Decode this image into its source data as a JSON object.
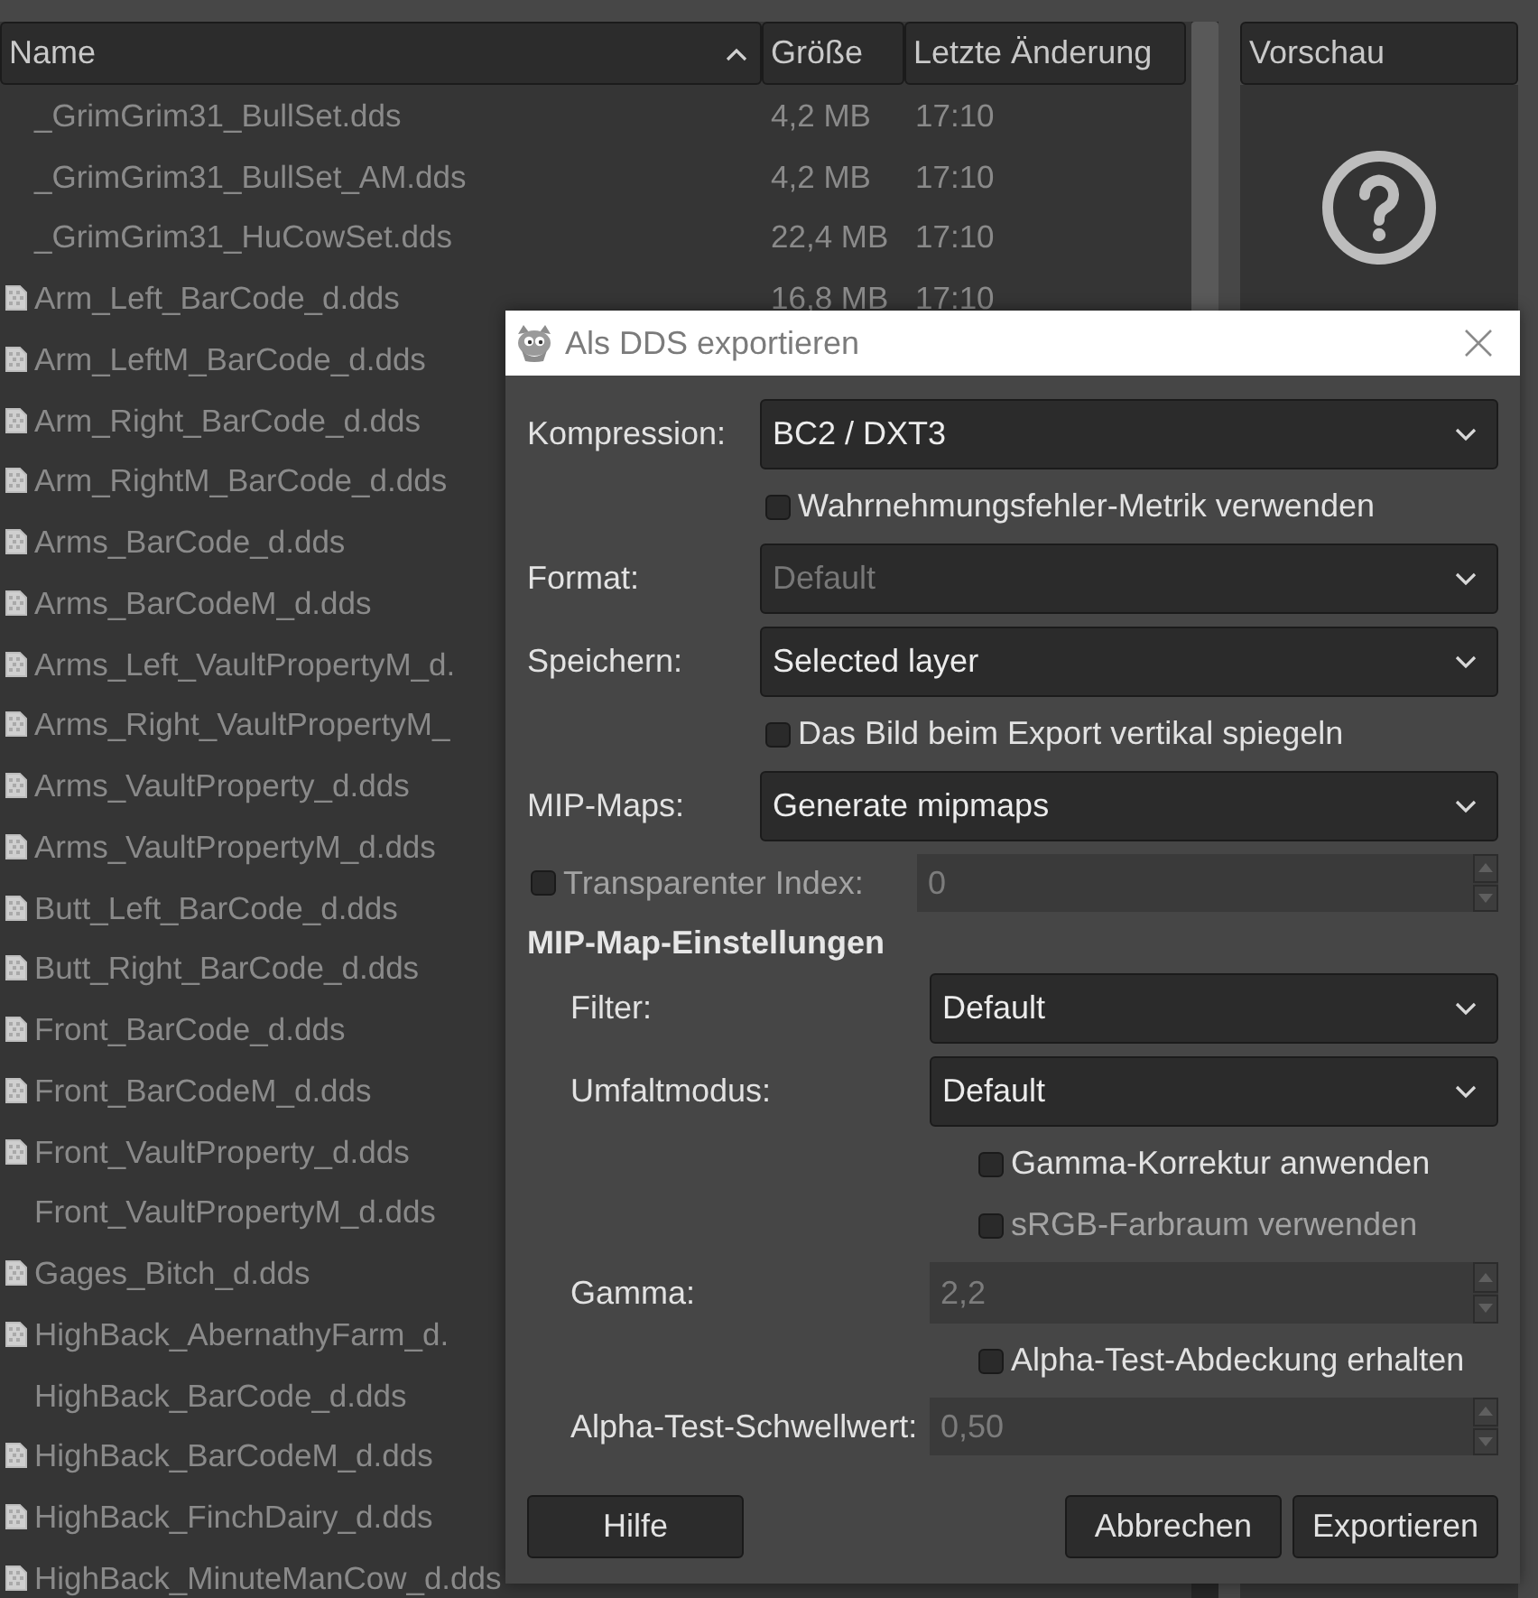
{
  "file_list": {
    "columns": [
      {
        "label": "Name",
        "sorted": true
      },
      {
        "label": "Größe",
        "sorted": false
      },
      {
        "label": "Letzte Änderung",
        "sorted": false
      }
    ],
    "rows": [
      {
        "name": "_GrimGrim31_BullSet.dds",
        "size": "4,2 MB",
        "modified": "17:10",
        "thumbnail": false
      },
      {
        "name": "_GrimGrim31_BullSet_AM.dds",
        "size": "4,2 MB",
        "modified": "17:10",
        "thumbnail": false
      },
      {
        "name": "_GrimGrim31_HuCowSet.dds",
        "size": "22,4 MB",
        "modified": "17:10",
        "thumbnail": false
      },
      {
        "name": "Arm_Left_BarCode_d.dds",
        "size": "16,8 MB",
        "modified": "17:10",
        "thumbnail": true
      },
      {
        "name": "Arm_LeftM_BarCode_d.dds",
        "thumbnail": true
      },
      {
        "name": "Arm_Right_BarCode_d.dds",
        "thumbnail": true
      },
      {
        "name": "Arm_RightM_BarCode_d.dds",
        "thumbnail": true
      },
      {
        "name": "Arms_BarCode_d.dds",
        "thumbnail": true
      },
      {
        "name": "Arms_BarCodeM_d.dds",
        "thumbnail": true
      },
      {
        "name": "Arms_Left_VaultPropertyM_d.",
        "thumbnail": true
      },
      {
        "name": "Arms_Right_VaultPropertyM_",
        "thumbnail": true
      },
      {
        "name": "Arms_VaultProperty_d.dds",
        "thumbnail": true
      },
      {
        "name": "Arms_VaultPropertyM_d.dds",
        "thumbnail": true
      },
      {
        "name": "Butt_Left_BarCode_d.dds",
        "thumbnail": true
      },
      {
        "name": "Butt_Right_BarCode_d.dds",
        "thumbnail": true
      },
      {
        "name": "Front_BarCode_d.dds",
        "thumbnail": true
      },
      {
        "name": "Front_BarCodeM_d.dds",
        "thumbnail": true
      },
      {
        "name": "Front_VaultProperty_d.dds",
        "thumbnail": true
      },
      {
        "name": "Front_VaultPropertyM_d.dds",
        "thumbnail": false
      },
      {
        "name": "Gages_Bitch_d.dds",
        "thumbnail": true
      },
      {
        "name": "HighBack_AbernathyFarm_d.",
        "thumbnail": true
      },
      {
        "name": "HighBack_BarCode_d.dds",
        "thumbnail": false
      },
      {
        "name": "HighBack_BarCodeM_d.dds",
        "thumbnail": true
      },
      {
        "name": "HighBack_FinchDairy_d.dds",
        "thumbnail": true
      },
      {
        "name": "HighBack_MinuteManCow_d.dds",
        "thumbnail": true
      }
    ]
  },
  "preview": {
    "title": "Vorschau"
  },
  "dialog": {
    "title": "Als DDS exportieren",
    "fields": [
      {
        "kind": "select",
        "label": "Kompression:",
        "value": "BC2 / DXT3",
        "disabled": false
      },
      {
        "kind": "checkbox",
        "label": "Wahrnehmungsfehler-Metrik verwenden",
        "checked": false,
        "disabled": false
      },
      {
        "kind": "select",
        "label": "Format:",
        "value": "Default",
        "disabled": true
      },
      {
        "kind": "select",
        "label": "Speichern:",
        "value": "Selected layer",
        "disabled": false
      },
      {
        "kind": "checkbox",
        "label": "Das Bild beim Export vertikal spiegeln",
        "checked": false,
        "disabled": false
      },
      {
        "kind": "select",
        "label": "MIP-Maps:",
        "value": "Generate mipmaps",
        "disabled": false
      },
      {
        "kind": "check_spin",
        "label": "Transparenter Index:",
        "checked": false,
        "value": "0",
        "disabled": true
      }
    ],
    "mipmap_settings": {
      "heading": "MIP-Map-Einstellungen",
      "fields": [
        {
          "kind": "select",
          "label": "Filter:",
          "value": "Default",
          "disabled": false
        },
        {
          "kind": "select",
          "label": "Umfaltmodus:",
          "value": "Default",
          "disabled": false
        },
        {
          "kind": "checkbox",
          "label": "Gamma-Korrektur anwenden",
          "checked": false,
          "disabled": false
        },
        {
          "kind": "checkbox",
          "label": "sRGB-Farbraum verwenden",
          "checked": false,
          "disabled": true
        },
        {
          "kind": "spin",
          "label": "Gamma:",
          "value": "2,2",
          "disabled": true
        },
        {
          "kind": "checkbox",
          "label": "Alpha-Test-Abdeckung erhalten",
          "checked": false,
          "disabled": false
        },
        {
          "kind": "spin",
          "label": "Alpha-Test-Schwellwert:",
          "value": "0,50",
          "disabled": true
        }
      ]
    },
    "buttons": [
      {
        "label": "Hilfe",
        "kind": "help"
      },
      {
        "label": "Abbrechen",
        "kind": "cancel"
      },
      {
        "label": "Exportieren",
        "kind": "confirm"
      }
    ]
  }
}
